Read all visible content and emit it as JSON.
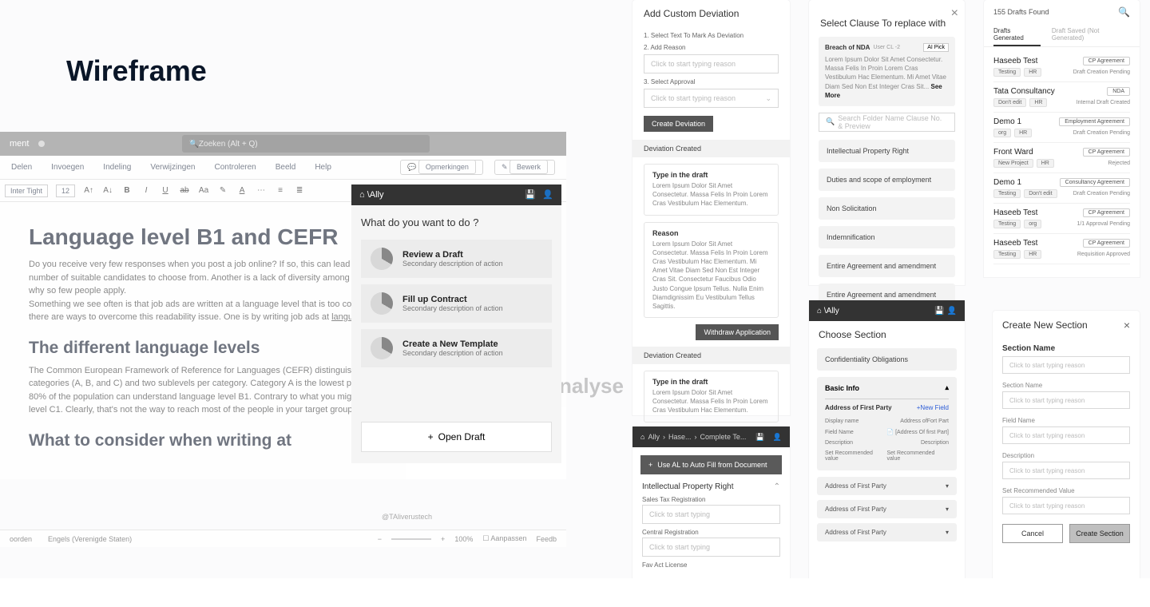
{
  "title": "Wireframe",
  "word": {
    "topbar_left": "ment",
    "search_placeholder": "Zoeken (Alt + Q)",
    "menu": [
      "Delen",
      "Invoegen",
      "Indeling",
      "Verwijzingen",
      "Controleren",
      "Beeld",
      "Help"
    ],
    "menu_right": [
      "Opmerkingen",
      "Bewerk"
    ],
    "ribbon": {
      "font": "Inter Tight",
      "size": "12"
    },
    "h1": "Language level B1 and CEFR",
    "p1": "Do you receive very few responses when you post a job online? If so, this can lead to several problems. One is the very limited number of suitable candidates to choose from. Another is a lack of diversity among the candidates that do apply. It's time to find out why so few people apply.",
    "p2a": "Something we see often is that job ads are written at a language level that is too complex for most people to understand. Luckily, there are ways to overcome this readability issue. One is by writing job ads at ",
    "p2link": "language level B1",
    "h2": "The different language levels",
    "p3": "The Common European Framework of Reference for Languages (CEFR) distinguishes six language levels. There are three main categories (A, B, and C) and two sublevels per category. Category A is the lowest proficiency and category C is the highest. About 80% of the population can understand language level B1. Contrary to what you might think, most job ads are written at language level C1. Clearly, that's not the way to reach most of the people in your target group.",
    "h3": "What to consider when writing at",
    "author": "@TAliverustech",
    "trailing": "nalyse",
    "status_left": [
      "oorden",
      "Engels (Verenigde Staten)"
    ],
    "status_right": [
      "100%",
      "Aanpassen",
      "Feedb"
    ]
  },
  "ally": {
    "brand": "\\Ally",
    "question": "What do you want to do ?",
    "actions": [
      {
        "t": "Review a Draft",
        "s": "Secondary description of action"
      },
      {
        "t": "Fill up Contract",
        "s": "Secondary description of action"
      },
      {
        "t": "Create a New Template",
        "s": "Secondary description of action"
      }
    ],
    "open_draft": "Open Draft"
  },
  "dev": {
    "title": "Add Custom Deviation",
    "step1": "1. Select Text To Mark As Deviation",
    "step2": "2. Add Reason",
    "ph_reason": "Click to start typing reason",
    "step3": "3. Select Approval",
    "ph_approval": "Click to start typing reason",
    "create": "Create Deviation",
    "created": "Deviation Created",
    "type_lbl": "Type in the draft",
    "type_txt": "Lorem Ipsum Dolor Sit Amet Consectetur. Massa Felis In Proin Lorem Cras Vestibulum Hac Elementum.",
    "reason_lbl": "Reason",
    "reason_txt": "Lorem Ipsum Dolor Sit Amet Consectetur. Massa Felis In Proin Lorem Cras Vestibulum Hac Elementum. Mi Amet Vitae Diam Sed Non Est Integer Cras Sit. Consectetur Faucibus Odio Justo Congue Ipsum Tellus. Nulla Enim Diamdignissim Eu Vestibulum Tellus Sagittis.",
    "withdraw": "Withdraw Application"
  },
  "clause": {
    "title": "Select Clause To replace with",
    "hero_name": "Breach of NDA",
    "hero_code": "User CL -2",
    "hero_pick": "AI Pick",
    "hero_body": "Lorem Ipsum Dolor Sit Amet Consectetur. Massa Felis In Proin Lorem Cras Vestibulum Hac Elementum. Mi Amet Vitae Diam Sed Non Est Integer Cras Sit... ",
    "hero_more": "See More",
    "search_ph": "Search Folder Name Clause No. & Preview",
    "rows": [
      "Intellectual Property Right",
      "Duties and scope of employment",
      "Non Solicitation",
      "Indemnification",
      "Entire Agreement and amendment",
      "Entire Agreement and amendment"
    ]
  },
  "drafts": {
    "count": "155 Drafts Found",
    "tabs": [
      "Drafts Generated",
      "Draft Saved (Not Generated)"
    ],
    "items": [
      {
        "name": "Haseeb Test",
        "badge": "CP Agreement",
        "tags": [
          "Testing",
          "HR"
        ],
        "stat": "Draft Creation Pending"
      },
      {
        "name": "Tata Consultancy",
        "badge": "NDA",
        "tags": [
          "Don't edit",
          "HR"
        ],
        "stat": "Internal Draft Created"
      },
      {
        "name": "Demo 1",
        "badge": "Employment Agreement",
        "tags": [
          "org",
          "HR"
        ],
        "stat": "Draft Creation Pending"
      },
      {
        "name": "Front Ward",
        "badge": "CP Agreement",
        "tags": [
          "New Project",
          "HR"
        ],
        "stat": "Rejected"
      },
      {
        "name": "Demo 1",
        "badge": "Consultancy Agreement",
        "tags": [
          "Testing",
          "Don't edit"
        ],
        "stat": "Draft Creation Pending"
      },
      {
        "name": "Haseeb Test",
        "badge": "CP Agreement",
        "tags": [
          "Testing",
          "org"
        ],
        "stat": "1/1 Approval Pending"
      },
      {
        "name": "Haseeb Test",
        "badge": "CP Agreement",
        "tags": [
          "Testing",
          "HR"
        ],
        "stat": "Requisition Approved"
      }
    ]
  },
  "choose": {
    "brand": "\\Ally",
    "title": "Choose Section",
    "first": "Confidentiality Obligations",
    "basic_info": "Basic Info",
    "sub_name": "Address of First Party",
    "new_field": "+New Field",
    "kv": [
      {
        "k": "Display name",
        "v": "Address ofFort Part"
      },
      {
        "k": "Field Name",
        "v": "[Address Of first Part]"
      },
      {
        "k": "Description",
        "v": "Description"
      },
      {
        "k": "Set Recommended value",
        "v": "Set Recommended value"
      }
    ],
    "acc": [
      "Address of First Party",
      "Address of First Party",
      "Address of First Party"
    ]
  },
  "ipr": {
    "crumb1": "Ally",
    "crumb2": "Hase...",
    "crumb3": "Complete Te...",
    "autofill": "Use AL to Auto Fill from Document",
    "heading": "Intellectual Property Right",
    "f1": "Sales Tax Registration",
    "f2": "Central Registration",
    "f3": "Fav Act License",
    "ph": "Click to start typing"
  },
  "create": {
    "title": "Create New Section",
    "big": "Section Name",
    "labels": [
      "Section Name",
      "Field Name",
      "Description",
      "Set Recommended Value"
    ],
    "ph": "Click to start typing reason",
    "cancel": "Cancel",
    "submit": "Create Section"
  }
}
